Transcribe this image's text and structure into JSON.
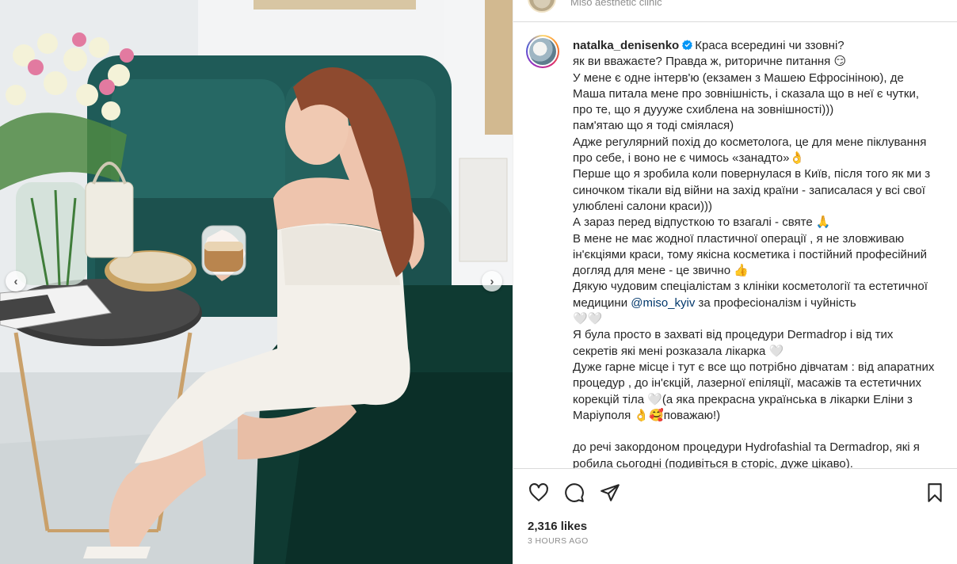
{
  "top_strip": {
    "label": "Miso aesthetic clinic"
  },
  "post": {
    "username": "natalka_denisenko",
    "caption_lines": [
      "Краса всередині чи ззовні?",
      "як ви вважаєте? Правда ж, риторичне питання 😏",
      "У мене є одне інтерв'ю (екзамен з Машею Ефросініною), де Маша питала мене про зовнішність, і сказала що в неї є чутки, про те, що я дуууже схиблена на зовнішності)))",
      "пам'ятаю що я тоді сміялася)",
      "Адже регулярний похід до косметолога, це для мене піклування про себе, і воно не є чимось «занадто»👌",
      "Перше що я зробила коли повернулася в Київ, після того як ми з синочком тікали від війни на захід країни - записалася у всі свої улюблені салони краси)))",
      "А зараз перед відпусткою то взагалі - святе 🙏",
      "В мене не має жодної пластичної операції , я не зловживаю ін'єкціями краси, тому якісна косметика і постійний професійний догляд для мене - це звично 👍",
      "Дякую чудовим спеціалістам з клініки косметології та естетичної медицини ",
      "@miso_kyiv",
      " за професіоналізм і чуйність",
      "🤍🤍",
      "Я була просто в захваті від процедури Dermadrop і від тих секретів які мені розказала лікарка 🤍",
      "Дуже гарне місце і тут є все що потрібно дівчатам : від апаратних процедур , до ін'єкцій, лазерної епіляції, масажів та естетичних корекцій тіла 🤍(а яка прекрасна українська в лікарки Еліни з Маріуполя 👌🥰поважаю!)",
      "",
      "до речі закордоном процедури Hydrofashial та Dermadrop, які я робила сьогодні (подивіться в сторіс, дуже цікаво)."
    ]
  },
  "actions": {
    "like_icon": "heart-icon",
    "comment_icon": "comment-icon",
    "share_icon": "paper-plane-icon",
    "save_icon": "bookmark-icon"
  },
  "stats": {
    "likes": "2,316 likes",
    "time_ago": "3 HOURS AGO"
  },
  "carousel": {
    "prev_glyph": "‹",
    "next_glyph": "›"
  },
  "colors": {
    "accent_link": "#00376b",
    "verified": "#0095f6",
    "muted": "#8e8e8e"
  }
}
